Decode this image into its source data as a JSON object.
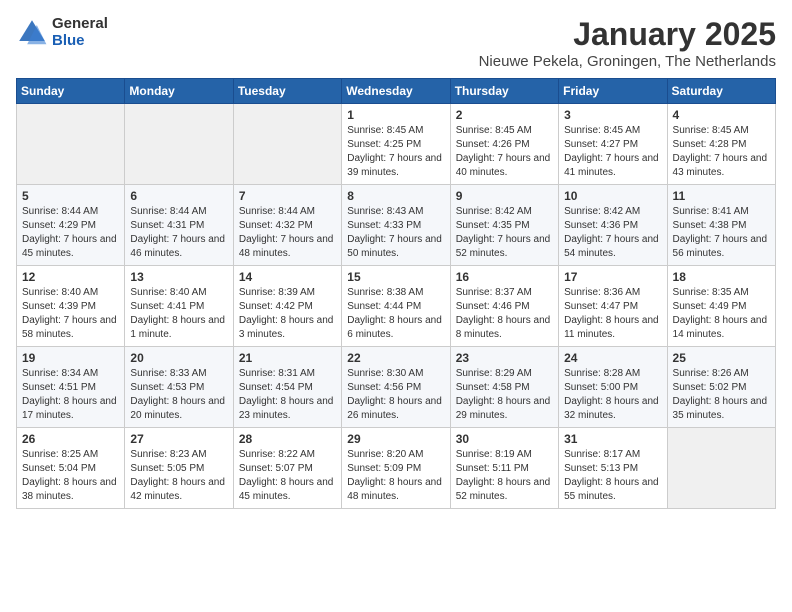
{
  "logo": {
    "general": "General",
    "blue": "Blue"
  },
  "title": "January 2025",
  "subtitle": "Nieuwe Pekela, Groningen, The Netherlands",
  "days_of_week": [
    "Sunday",
    "Monday",
    "Tuesday",
    "Wednesday",
    "Thursday",
    "Friday",
    "Saturday"
  ],
  "weeks": [
    [
      {
        "day": "",
        "info": ""
      },
      {
        "day": "",
        "info": ""
      },
      {
        "day": "",
        "info": ""
      },
      {
        "day": "1",
        "info": "Sunrise: 8:45 AM\nSunset: 4:25 PM\nDaylight: 7 hours\nand 39 minutes."
      },
      {
        "day": "2",
        "info": "Sunrise: 8:45 AM\nSunset: 4:26 PM\nDaylight: 7 hours\nand 40 minutes."
      },
      {
        "day": "3",
        "info": "Sunrise: 8:45 AM\nSunset: 4:27 PM\nDaylight: 7 hours\nand 41 minutes."
      },
      {
        "day": "4",
        "info": "Sunrise: 8:45 AM\nSunset: 4:28 PM\nDaylight: 7 hours\nand 43 minutes."
      }
    ],
    [
      {
        "day": "5",
        "info": "Sunrise: 8:44 AM\nSunset: 4:29 PM\nDaylight: 7 hours\nand 45 minutes."
      },
      {
        "day": "6",
        "info": "Sunrise: 8:44 AM\nSunset: 4:31 PM\nDaylight: 7 hours\nand 46 minutes."
      },
      {
        "day": "7",
        "info": "Sunrise: 8:44 AM\nSunset: 4:32 PM\nDaylight: 7 hours\nand 48 minutes."
      },
      {
        "day": "8",
        "info": "Sunrise: 8:43 AM\nSunset: 4:33 PM\nDaylight: 7 hours\nand 50 minutes."
      },
      {
        "day": "9",
        "info": "Sunrise: 8:42 AM\nSunset: 4:35 PM\nDaylight: 7 hours\nand 52 minutes."
      },
      {
        "day": "10",
        "info": "Sunrise: 8:42 AM\nSunset: 4:36 PM\nDaylight: 7 hours\nand 54 minutes."
      },
      {
        "day": "11",
        "info": "Sunrise: 8:41 AM\nSunset: 4:38 PM\nDaylight: 7 hours\nand 56 minutes."
      }
    ],
    [
      {
        "day": "12",
        "info": "Sunrise: 8:40 AM\nSunset: 4:39 PM\nDaylight: 7 hours\nand 58 minutes."
      },
      {
        "day": "13",
        "info": "Sunrise: 8:40 AM\nSunset: 4:41 PM\nDaylight: 8 hours\nand 1 minute."
      },
      {
        "day": "14",
        "info": "Sunrise: 8:39 AM\nSunset: 4:42 PM\nDaylight: 8 hours\nand 3 minutes."
      },
      {
        "day": "15",
        "info": "Sunrise: 8:38 AM\nSunset: 4:44 PM\nDaylight: 8 hours\nand 6 minutes."
      },
      {
        "day": "16",
        "info": "Sunrise: 8:37 AM\nSunset: 4:46 PM\nDaylight: 8 hours\nand 8 minutes."
      },
      {
        "day": "17",
        "info": "Sunrise: 8:36 AM\nSunset: 4:47 PM\nDaylight: 8 hours\nand 11 minutes."
      },
      {
        "day": "18",
        "info": "Sunrise: 8:35 AM\nSunset: 4:49 PM\nDaylight: 8 hours\nand 14 minutes."
      }
    ],
    [
      {
        "day": "19",
        "info": "Sunrise: 8:34 AM\nSunset: 4:51 PM\nDaylight: 8 hours\nand 17 minutes."
      },
      {
        "day": "20",
        "info": "Sunrise: 8:33 AM\nSunset: 4:53 PM\nDaylight: 8 hours\nand 20 minutes."
      },
      {
        "day": "21",
        "info": "Sunrise: 8:31 AM\nSunset: 4:54 PM\nDaylight: 8 hours\nand 23 minutes."
      },
      {
        "day": "22",
        "info": "Sunrise: 8:30 AM\nSunset: 4:56 PM\nDaylight: 8 hours\nand 26 minutes."
      },
      {
        "day": "23",
        "info": "Sunrise: 8:29 AM\nSunset: 4:58 PM\nDaylight: 8 hours\nand 29 minutes."
      },
      {
        "day": "24",
        "info": "Sunrise: 8:28 AM\nSunset: 5:00 PM\nDaylight: 8 hours\nand 32 minutes."
      },
      {
        "day": "25",
        "info": "Sunrise: 8:26 AM\nSunset: 5:02 PM\nDaylight: 8 hours\nand 35 minutes."
      }
    ],
    [
      {
        "day": "26",
        "info": "Sunrise: 8:25 AM\nSunset: 5:04 PM\nDaylight: 8 hours\nand 38 minutes."
      },
      {
        "day": "27",
        "info": "Sunrise: 8:23 AM\nSunset: 5:05 PM\nDaylight: 8 hours\nand 42 minutes."
      },
      {
        "day": "28",
        "info": "Sunrise: 8:22 AM\nSunset: 5:07 PM\nDaylight: 8 hours\nand 45 minutes."
      },
      {
        "day": "29",
        "info": "Sunrise: 8:20 AM\nSunset: 5:09 PM\nDaylight: 8 hours\nand 48 minutes."
      },
      {
        "day": "30",
        "info": "Sunrise: 8:19 AM\nSunset: 5:11 PM\nDaylight: 8 hours\nand 52 minutes."
      },
      {
        "day": "31",
        "info": "Sunrise: 8:17 AM\nSunset: 5:13 PM\nDaylight: 8 hours\nand 55 minutes."
      },
      {
        "day": "",
        "info": ""
      }
    ]
  ]
}
